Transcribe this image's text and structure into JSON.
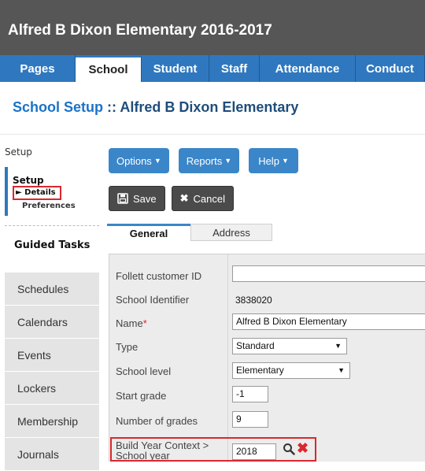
{
  "header": {
    "school_title": "Alfred B Dixon Elementary 2016-2017"
  },
  "tabs": [
    {
      "label": "Pages",
      "active": false
    },
    {
      "label": "School",
      "active": true
    },
    {
      "label": "Student",
      "active": false
    },
    {
      "label": "Staff",
      "active": false
    },
    {
      "label": "Attendance",
      "active": false
    },
    {
      "label": "Conduct",
      "active": false
    }
  ],
  "page": {
    "heading_link": "School Setup",
    "heading_rest": " :: Alfred B Dixon Elementary"
  },
  "leftnav": {
    "section_label": "Setup",
    "setup_title": "Setup",
    "details_label": "Details",
    "preferences_label": "Preferences",
    "guided_tasks": "Guided Tasks",
    "items": [
      "Schedules",
      "Calendars",
      "Events",
      "Lockers",
      "Membership",
      "Journals"
    ]
  },
  "toolbar": {
    "options_label": "Options",
    "reports_label": "Reports",
    "help_label": "Help",
    "save_label": "Save",
    "cancel_label": "Cancel"
  },
  "subtabs": {
    "general": "General",
    "address": "Address"
  },
  "form": {
    "follett_id_label": "Follett customer ID",
    "follett_id_value": "",
    "school_identifier_label": "School Identifier",
    "school_identifier_value": "3838020",
    "name_label": "Name",
    "name_required_marker": "*",
    "name_value": "Alfred B Dixon Elementary",
    "type_label": "Type",
    "type_value": "Standard",
    "school_level_label": "School level",
    "school_level_value": "Elementary",
    "start_grade_label": "Start grade",
    "start_grade_value": "-1",
    "num_grades_label": "Number of grades",
    "num_grades_value": "9",
    "build_year_label_line1": "Build Year Context >",
    "build_year_label_line2": "School year",
    "build_year_value": "2018"
  },
  "colors": {
    "topbar": "#565656",
    "tabbar": "#2f78bf",
    "button_blue": "#3b86c9",
    "highlight_red": "#d9282f"
  },
  "icons": {
    "details_arrow": "triangle-right-icon",
    "save": "floppy-disk-icon",
    "cancel": "x-icon",
    "lookup": "search-icon",
    "clear": "x-icon"
  }
}
